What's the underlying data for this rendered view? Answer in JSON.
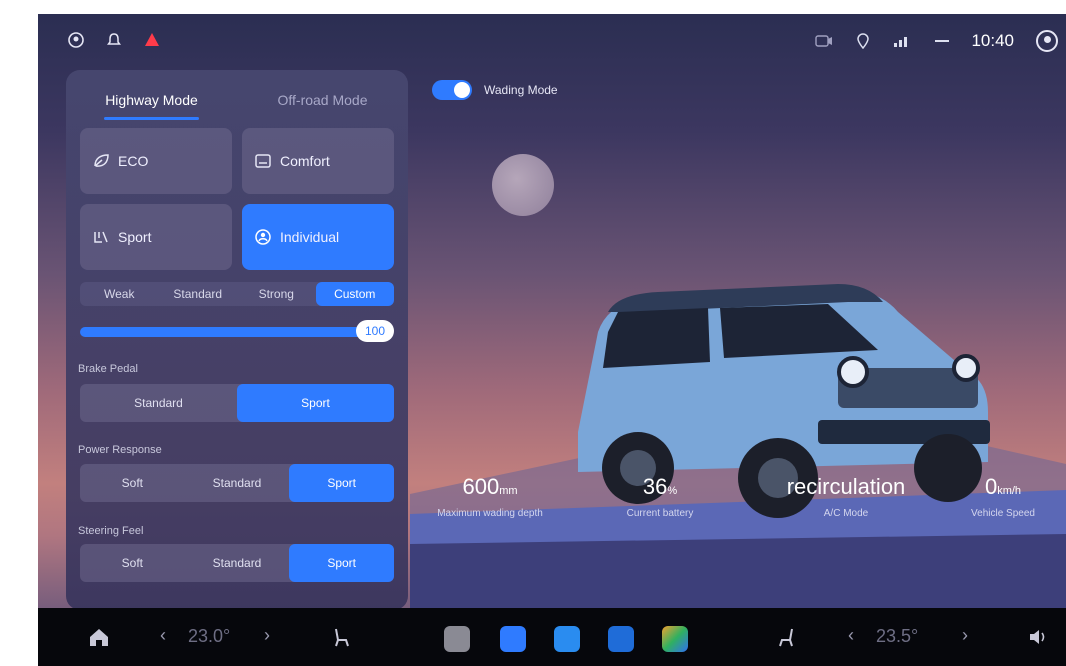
{
  "status_bar": {
    "time": "10:40",
    "profile_text": ""
  },
  "panel": {
    "tabs": [
      {
        "label": "Highway Mode",
        "active": true
      },
      {
        "label": "Off-road Mode",
        "active": false
      }
    ],
    "modes": [
      {
        "label": "ECO",
        "icon": "leaf-icon",
        "selected": false
      },
      {
        "label": "Comfort",
        "icon": "seat-icon",
        "selected": false
      },
      {
        "label": "Sport",
        "icon": "sport-seat-icon",
        "selected": false
      },
      {
        "label": "Individual",
        "icon": "person-icon",
        "selected": true
      }
    ],
    "levels": [
      "Weak",
      "Standard",
      "Strong",
      "Custom"
    ],
    "selected_level": "Custom",
    "slider_value": "100",
    "brake_pedal": {
      "label": "Brake Pedal",
      "options": [
        "Standard",
        "Sport"
      ],
      "selected": "Sport"
    },
    "power_response": {
      "label": "Power Response",
      "options": [
        "Soft",
        "Standard",
        "Sport"
      ],
      "selected": "Sport"
    },
    "steering_feel": {
      "label": "Steering Feel",
      "options": [
        "Soft",
        "Standard",
        "Sport"
      ],
      "selected": "Sport"
    }
  },
  "wading": {
    "label": "Wading Mode",
    "enabled": true
  },
  "stats": [
    {
      "value": "600",
      "unit": "mm",
      "label": "Maximum wading depth"
    },
    {
      "value": "36",
      "unit": "%",
      "label": "Current battery"
    },
    {
      "value": "recirculation",
      "unit": "",
      "label": "A/C Mode"
    },
    {
      "value": "0",
      "unit": "km/h",
      "label": "Vehicle Speed"
    }
  ],
  "dock": {
    "left_temp": "23.0°",
    "right_temp": "23.5°",
    "apps": [
      "settings-app",
      "browser-app",
      "messages-app",
      "phone-app",
      "gallery-app"
    ]
  },
  "colors": {
    "accent": "#2f7bff",
    "dock": "#06070c"
  }
}
